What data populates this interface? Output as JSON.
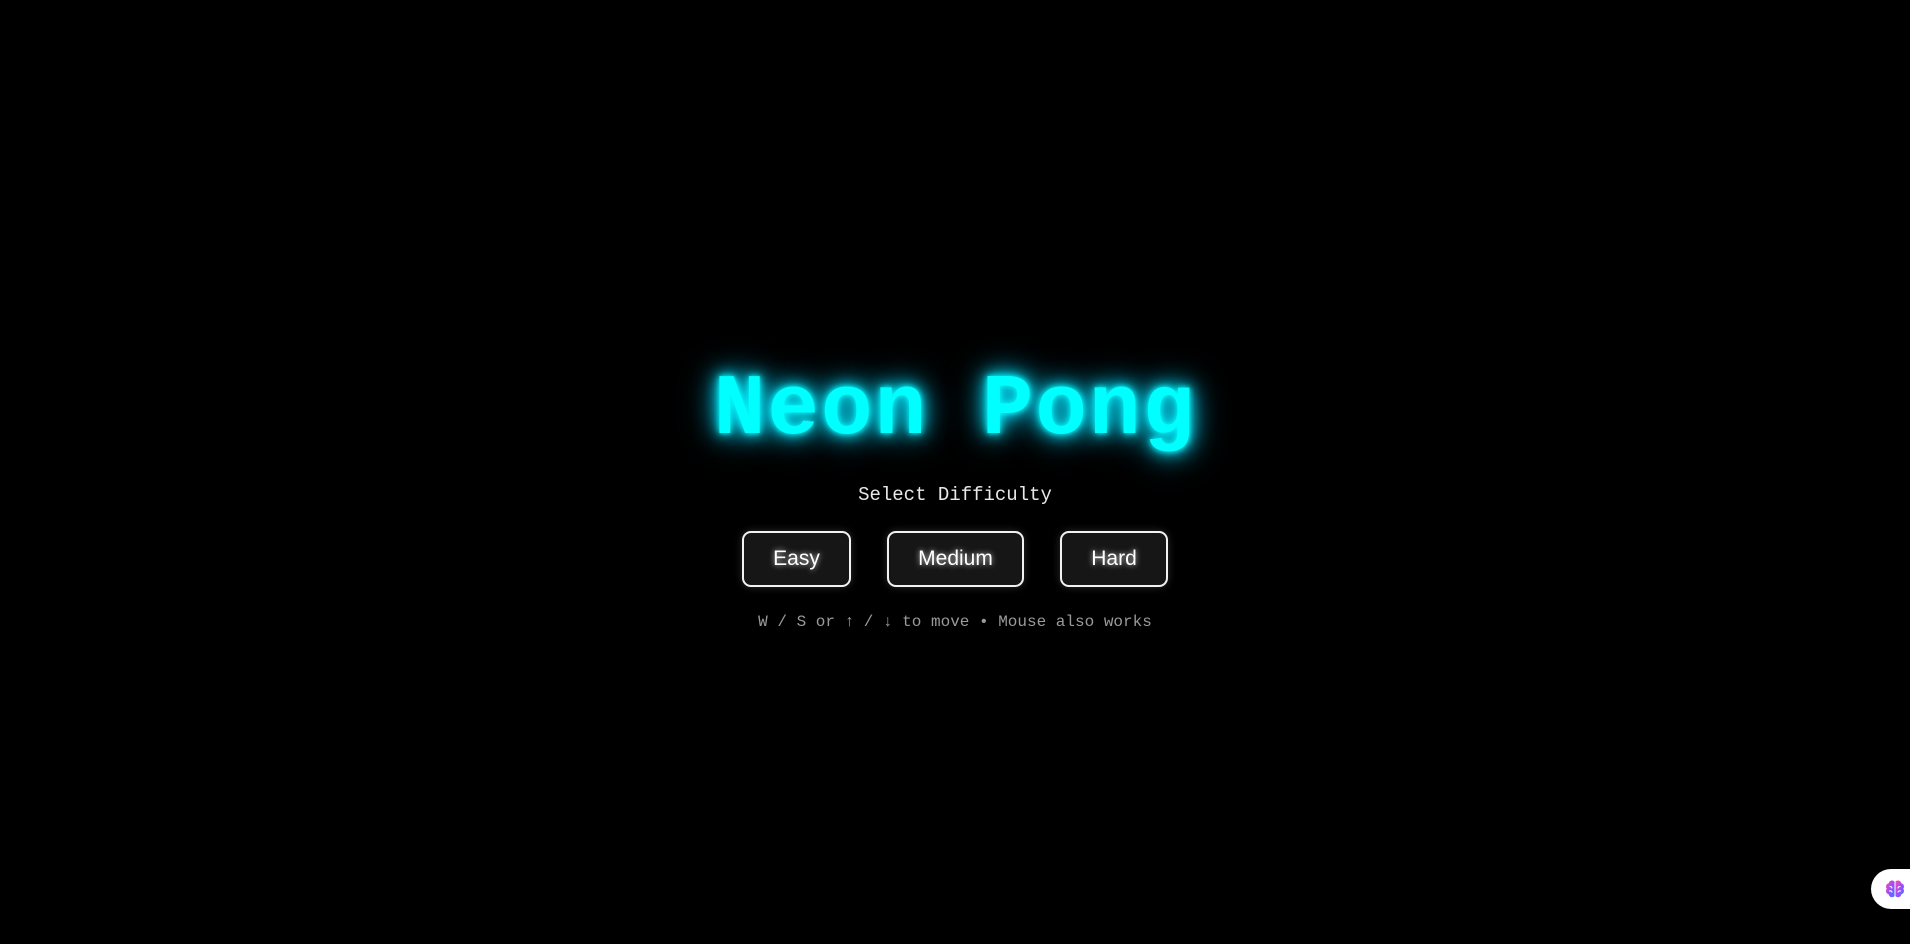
{
  "game": {
    "title": "Neon Pong",
    "subtitle": "Select Difficulty",
    "difficulties": [
      "Easy",
      "Medium",
      "Hard"
    ],
    "controls_hint": "W / S or ↑ / ↓ to move • Mouse also works"
  },
  "colors": {
    "background": "#000000",
    "neon_title": "#00ffff",
    "button_border": "#f2f2f2",
    "hint_text": "#9a9a9a"
  },
  "corner_widget": {
    "icon": "brain-icon"
  }
}
